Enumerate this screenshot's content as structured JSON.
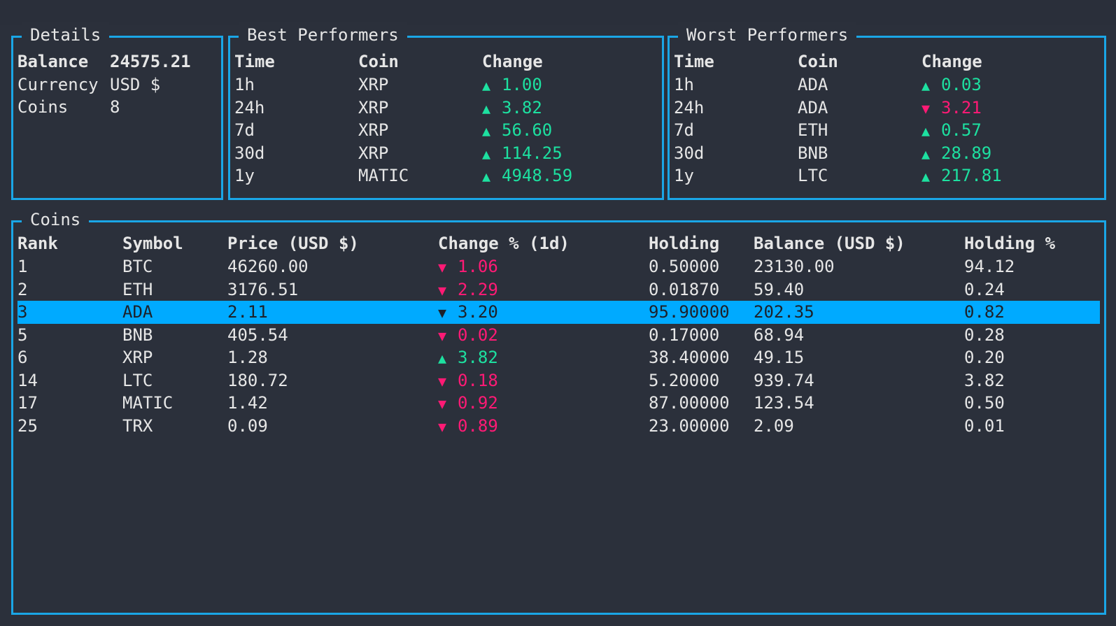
{
  "details": {
    "title": "Details",
    "rows": [
      {
        "label": "Balance",
        "value": "24575.21",
        "bold": true
      },
      {
        "label": "Currency",
        "value": "USD $",
        "bold": false
      },
      {
        "label": "Coins",
        "value": "8",
        "bold": false
      }
    ]
  },
  "best": {
    "title": "Best Performers",
    "headers": {
      "time": "Time",
      "coin": "Coin",
      "change": "Change"
    },
    "rows": [
      {
        "time": "1h",
        "coin": "XRP",
        "dir": "up",
        "change": "1.00"
      },
      {
        "time": "24h",
        "coin": "XRP",
        "dir": "up",
        "change": "3.82"
      },
      {
        "time": "7d",
        "coin": "XRP",
        "dir": "up",
        "change": "56.60"
      },
      {
        "time": "30d",
        "coin": "XRP",
        "dir": "up",
        "change": "114.25"
      },
      {
        "time": "1y",
        "coin": "MATIC",
        "dir": "up",
        "change": "4948.59"
      }
    ]
  },
  "worst": {
    "title": "Worst Performers",
    "headers": {
      "time": "Time",
      "coin": "Coin",
      "change": "Change"
    },
    "rows": [
      {
        "time": "1h",
        "coin": "ADA",
        "dir": "up",
        "change": "0.03"
      },
      {
        "time": "24h",
        "coin": "ADA",
        "dir": "down",
        "change": "3.21"
      },
      {
        "time": "7d",
        "coin": "ETH",
        "dir": "up",
        "change": "0.57"
      },
      {
        "time": "30d",
        "coin": "BNB",
        "dir": "up",
        "change": "28.89"
      },
      {
        "time": "1y",
        "coin": "LTC",
        "dir": "up",
        "change": "217.81"
      }
    ]
  },
  "coins": {
    "title": "Coins",
    "headers": {
      "rank": "Rank",
      "symbol": "Symbol",
      "price": "Price (USD $)",
      "change": "Change % (1d)",
      "holding": "Holding",
      "balance": "Balance (USD $)",
      "holding_pct": "Holding %"
    },
    "selected_index": 2,
    "rows": [
      {
        "rank": "1",
        "symbol": "BTC",
        "price": "46260.00",
        "dir": "down",
        "change": "1.06",
        "holding": "0.50000",
        "balance": "23130.00",
        "holding_pct": "94.12"
      },
      {
        "rank": "2",
        "symbol": "ETH",
        "price": "3176.51",
        "dir": "down",
        "change": "2.29",
        "holding": "0.01870",
        "balance": "59.40",
        "holding_pct": "0.24"
      },
      {
        "rank": "3",
        "symbol": "ADA",
        "price": "2.11",
        "dir": "down",
        "change": "3.20",
        "holding": "95.90000",
        "balance": "202.35",
        "holding_pct": "0.82"
      },
      {
        "rank": "5",
        "symbol": "BNB",
        "price": "405.54",
        "dir": "down",
        "change": "0.02",
        "holding": "0.17000",
        "balance": "68.94",
        "holding_pct": "0.28"
      },
      {
        "rank": "6",
        "symbol": "XRP",
        "price": "1.28",
        "dir": "up",
        "change": "3.82",
        "holding": "38.40000",
        "balance": "49.15",
        "holding_pct": "0.20"
      },
      {
        "rank": "14",
        "symbol": "LTC",
        "price": "180.72",
        "dir": "down",
        "change": "0.18",
        "holding": "5.20000",
        "balance": "939.74",
        "holding_pct": "3.82"
      },
      {
        "rank": "17",
        "symbol": "MATIC",
        "price": "1.42",
        "dir": "down",
        "change": "0.92",
        "holding": "87.00000",
        "balance": "123.54",
        "holding_pct": "0.50"
      },
      {
        "rank": "25",
        "symbol": "TRX",
        "price": "0.09",
        "dir": "down",
        "change": "0.89",
        "holding": "23.00000",
        "balance": "2.09",
        "holding_pct": "0.01"
      }
    ]
  },
  "arrows": {
    "up": "▲",
    "down": "▼"
  },
  "colors": {
    "border": "#1aa6e6",
    "up": "#1de0a0",
    "down": "#ff1a75",
    "selected": "#00aaff",
    "background": "#2b303b"
  }
}
